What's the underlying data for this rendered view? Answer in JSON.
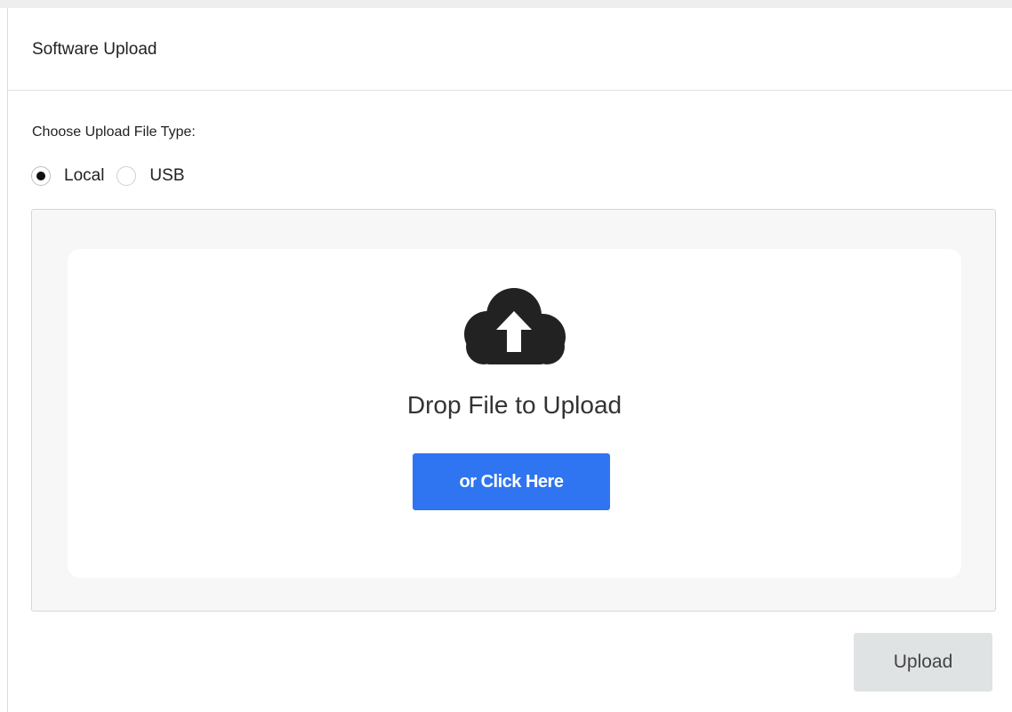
{
  "panel": {
    "title": "Software Upload"
  },
  "upload_type": {
    "label": "Choose Upload File Type:",
    "options": [
      {
        "label": "Local",
        "selected": true
      },
      {
        "label": "USB",
        "selected": false
      }
    ]
  },
  "dropzone": {
    "icon": "cloud-upload-icon",
    "title": "Drop File to Upload",
    "button_label": "or Click Here"
  },
  "actions": {
    "upload_label": "Upload"
  },
  "colors": {
    "primary_button": "#2f74f0",
    "disabled_button": "#dfe3e4",
    "icon": "#222222"
  }
}
